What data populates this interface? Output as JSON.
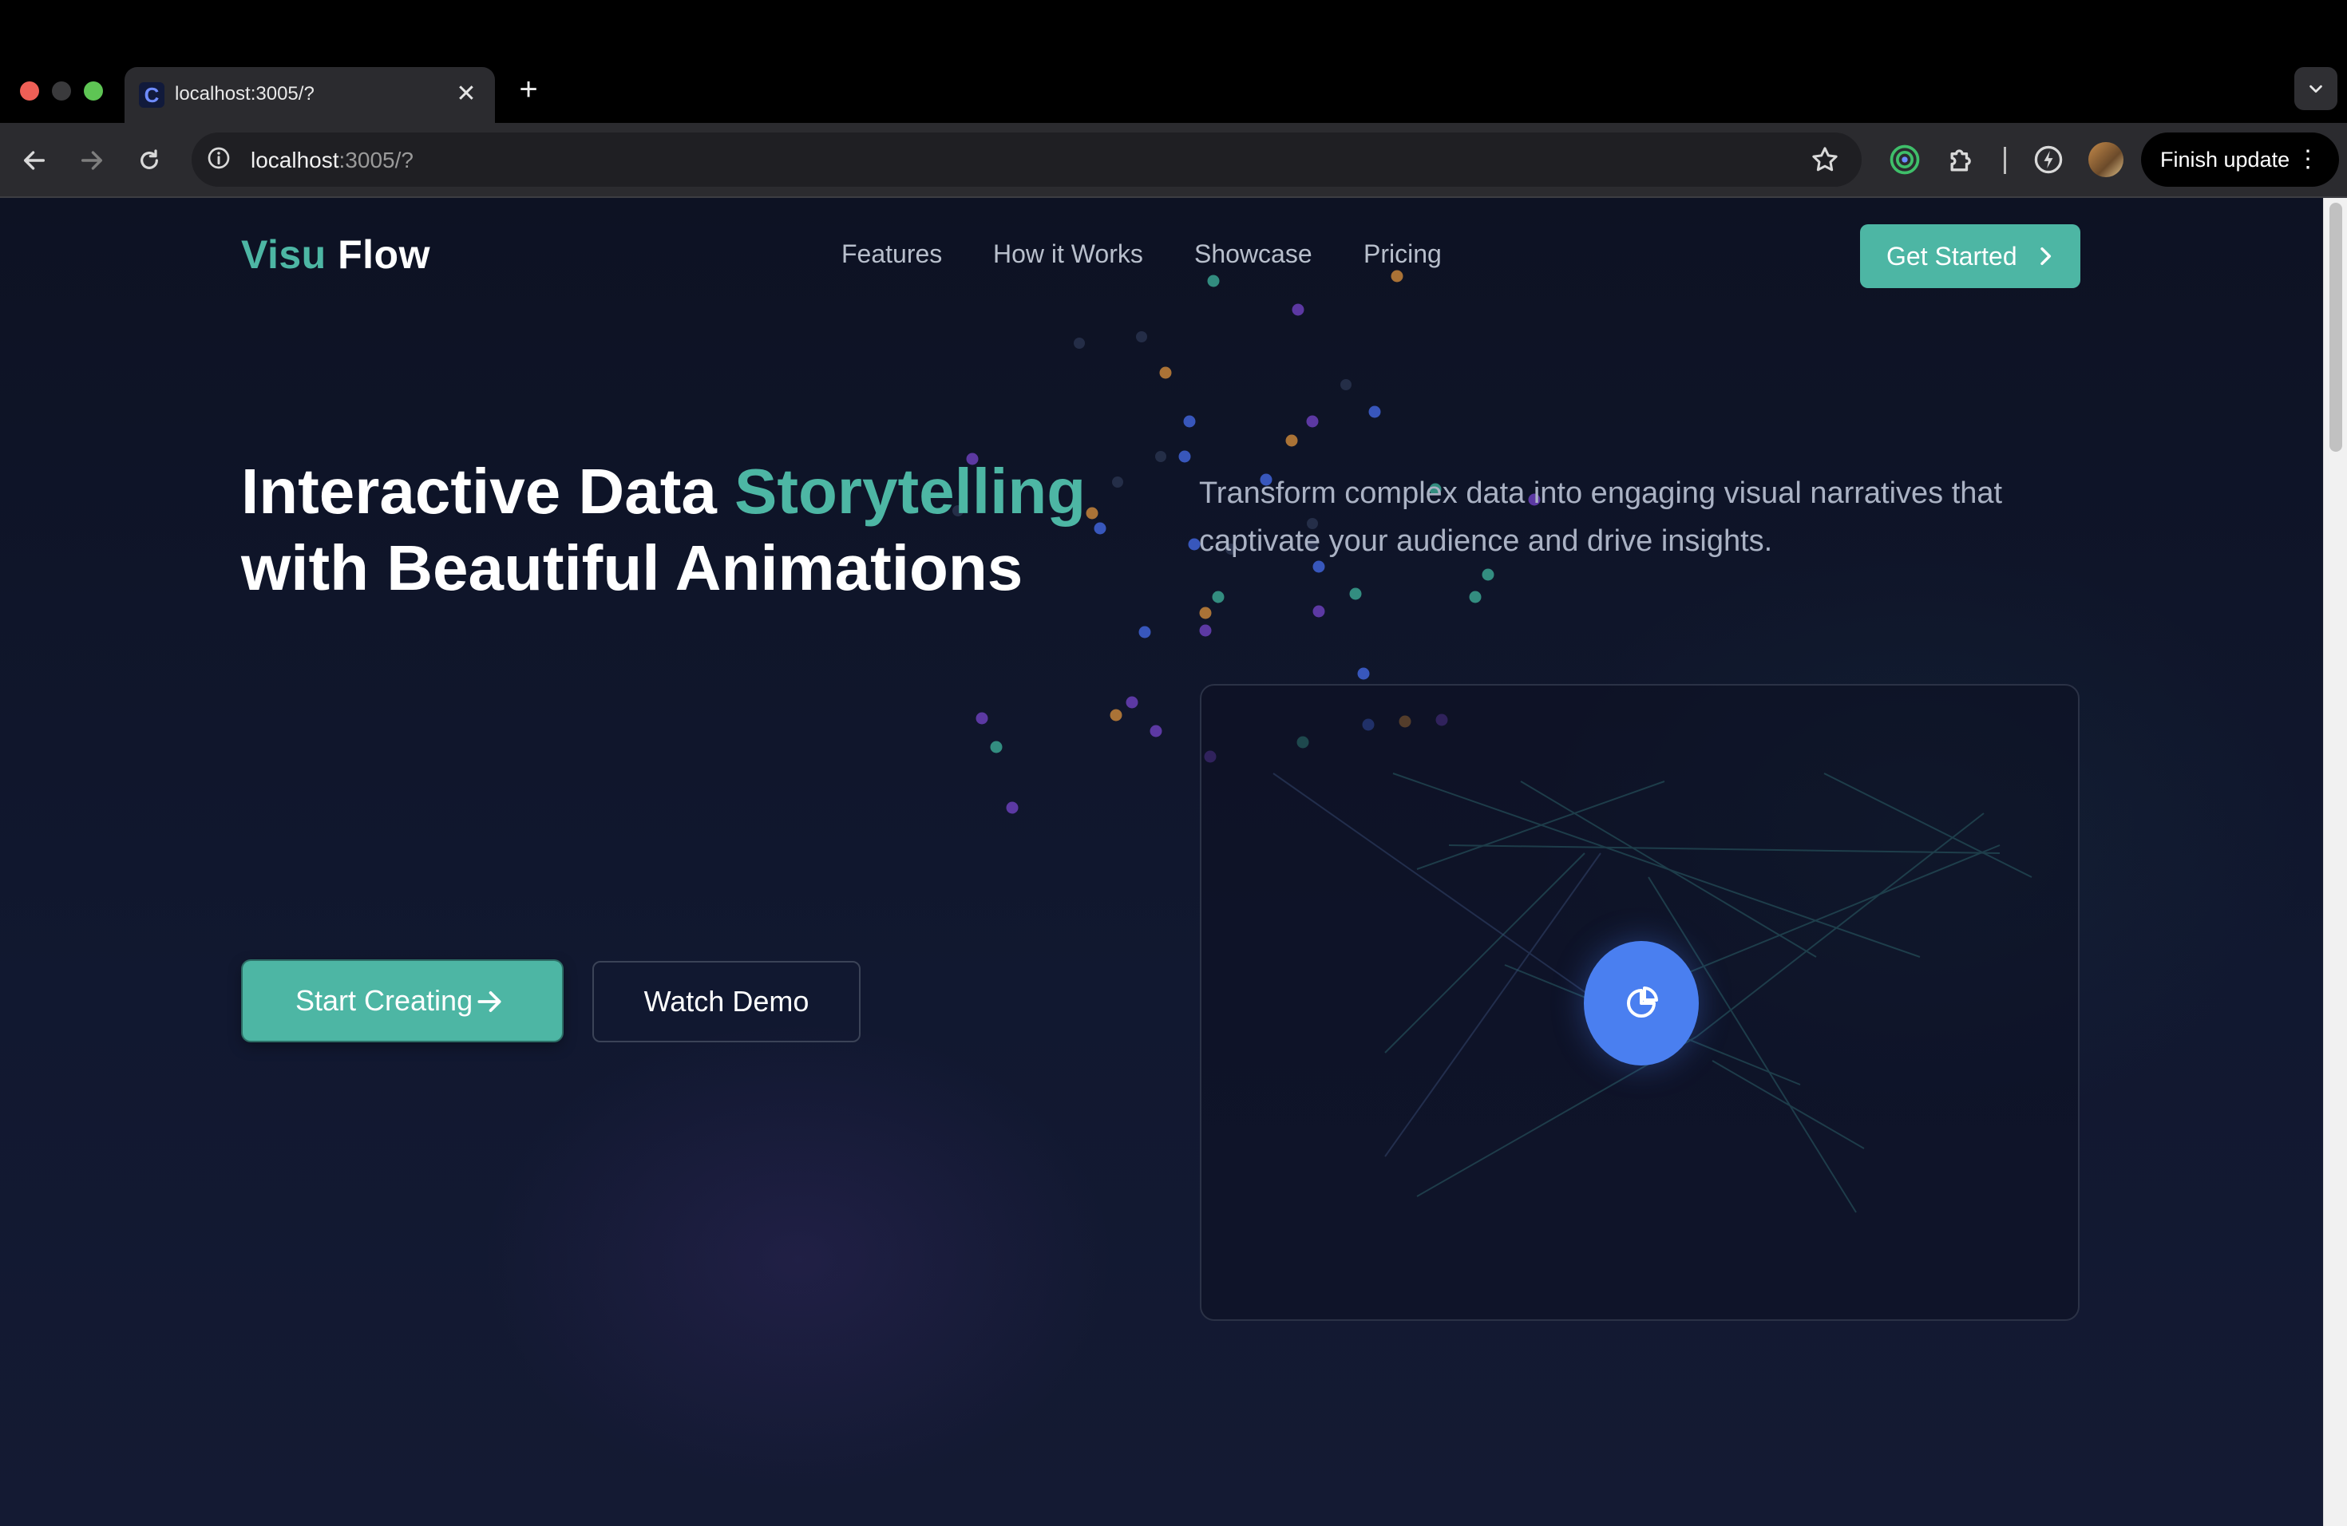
{
  "browser": {
    "tab_title": "localhost:3005/?",
    "tab_favicon": "C",
    "url_host": "localhost",
    "url_path": ":3005/?",
    "finish_update": "Finish update",
    "icons": {
      "back": "arrow-left-icon",
      "forward": "arrow-right-icon",
      "reload": "reload-icon",
      "site_info": "info-icon",
      "bookmark": "star-icon",
      "extensions": "puzzle-icon",
      "menu": "more-vertical-icon"
    }
  },
  "nav": {
    "logo_part1": "Visu",
    "logo_part2": "Flow",
    "links": [
      "Features",
      "How it Works",
      "Showcase",
      "Pricing"
    ],
    "cta": "Get Started"
  },
  "hero": {
    "headline_part1": "Interactive Data ",
    "headline_accent": "Storytelling",
    "headline_part2": "with Beautiful Animations",
    "subtext": "Transform complex data into engaging visual narratives that captivate your audience and drive insights.",
    "primary_button": "Start Creating",
    "secondary_button": "Watch Demo"
  },
  "colors": {
    "accent": "#4db6a4",
    "background": "#0d1223",
    "pie_button": "#4a7ff0",
    "dot_teal": "#3aa28f",
    "dot_purple": "#6a3fb8",
    "dot_blue": "#3f63d6",
    "dot_orange": "#c6843a"
  }
}
